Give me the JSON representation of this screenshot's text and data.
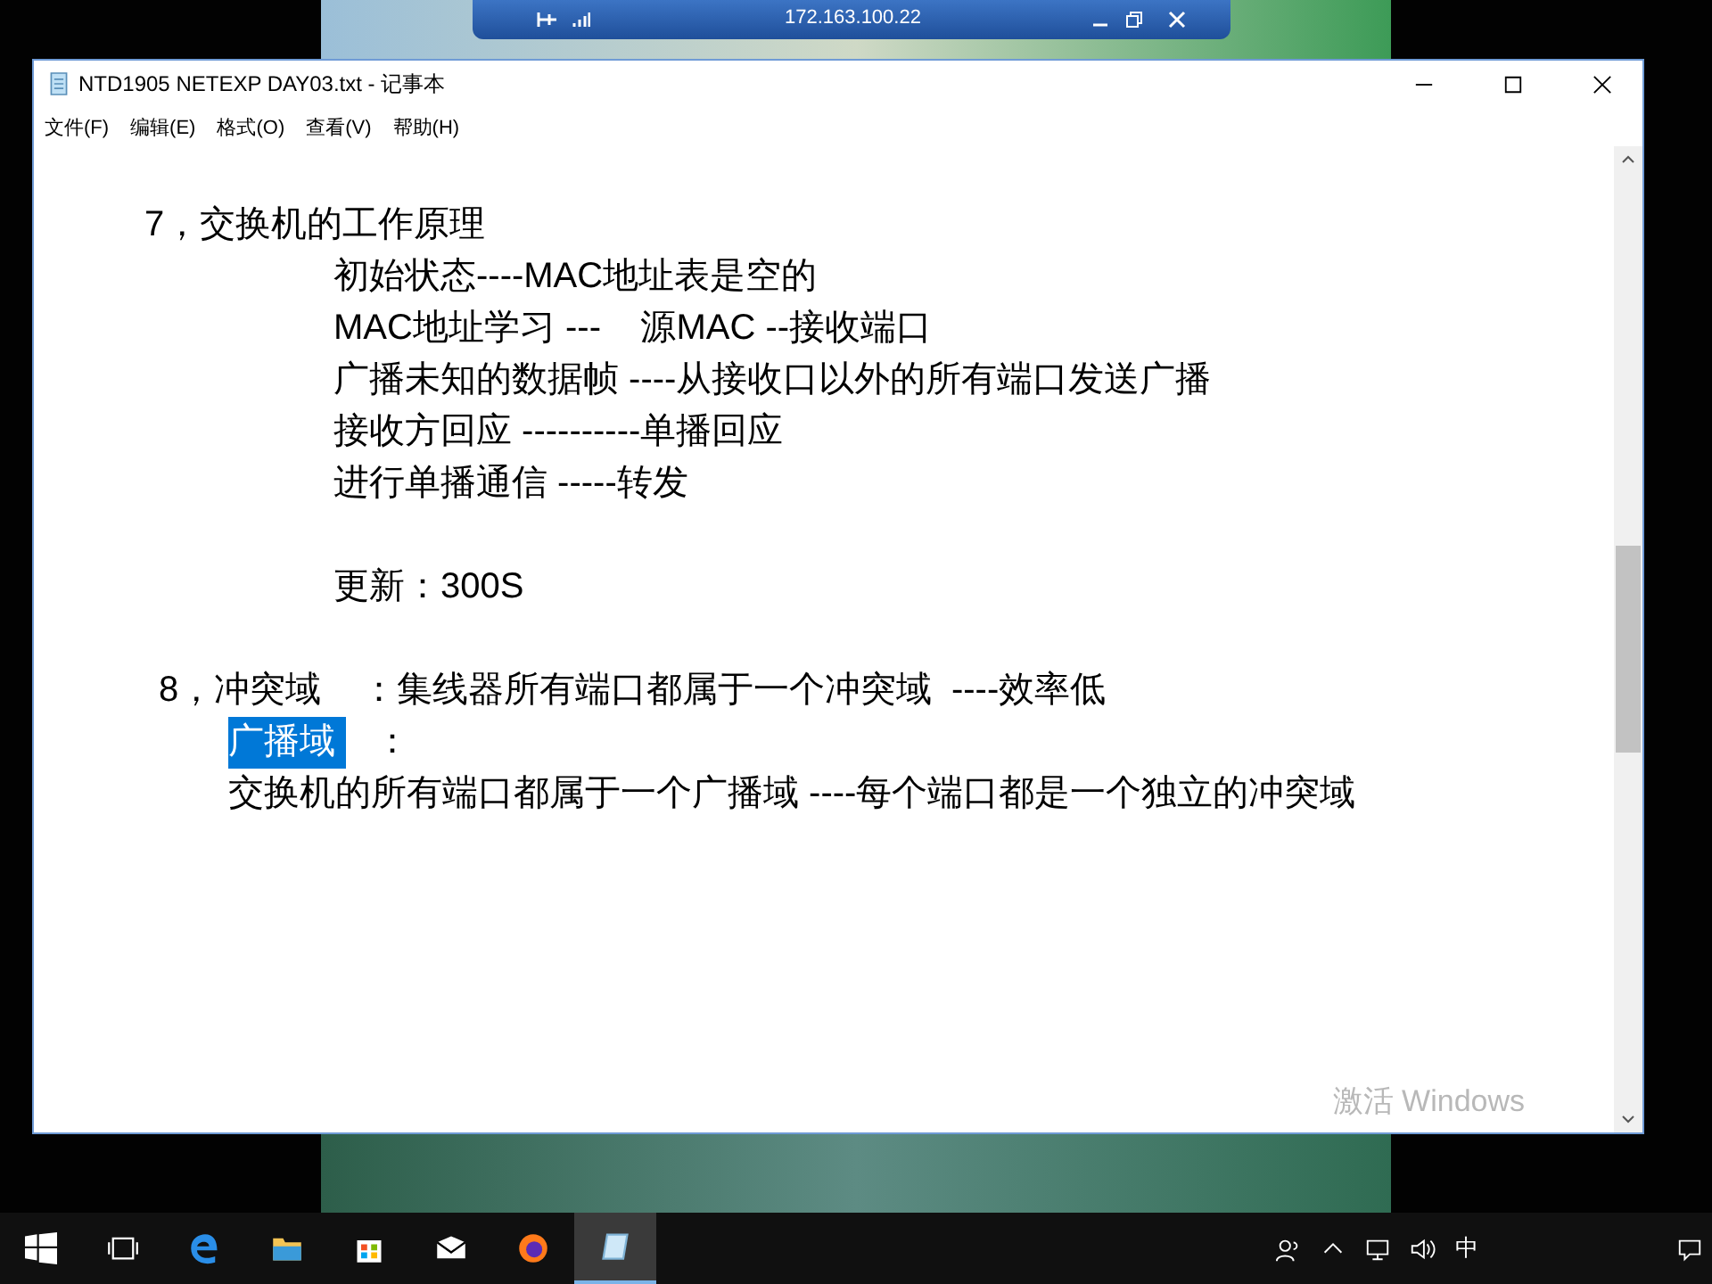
{
  "remote_bar": {
    "address": "172.163.100.22"
  },
  "window": {
    "title": "NTD1905 NETEXP DAY03.txt - 记事本"
  },
  "menu": [
    "文件(F)",
    "编辑(E)",
    "格式(O)",
    "查看(V)",
    "帮助(H)"
  ],
  "document": [
    {
      "kind": "heading",
      "segments": [
        {
          "text": "7，交换机的工作原理",
          "selected": false
        }
      ]
    },
    {
      "kind": "detail",
      "segments": [
        {
          "text": "初始状态----MAC地址表是空的",
          "selected": false
        }
      ]
    },
    {
      "kind": "detail",
      "segments": [
        {
          "text": "MAC地址学习 ---    源MAC --接收端口",
          "selected": false
        }
      ]
    },
    {
      "kind": "detail",
      "segments": [
        {
          "text": "广播未知的数据帧 ----从接收口以外的所有端口发送广播",
          "selected": false
        }
      ]
    },
    {
      "kind": "detail",
      "segments": [
        {
          "text": "接收方回应 ----------单播回应",
          "selected": false
        }
      ]
    },
    {
      "kind": "detail",
      "segments": [
        {
          "text": "进行单播通信 -----转发",
          "selected": false
        }
      ]
    },
    {
      "kind": "blank"
    },
    {
      "kind": "detail",
      "segments": [
        {
          "text": "更新：300S",
          "selected": false
        }
      ]
    },
    {
      "kind": "blank"
    },
    {
      "kind": "heading2",
      "segments": [
        {
          "text": "8，冲突域    ：集线器所有端口都属于一个冲突域  ----效率低",
          "selected": false
        }
      ]
    },
    {
      "kind": "continuation",
      "segments": [
        {
          "text": "广播域 ",
          "selected": true
        },
        {
          "text": "   ：",
          "selected": false
        }
      ]
    },
    {
      "kind": "continuation",
      "segments": [
        {
          "text": "交换机的所有端口都属于一个广播域 ----每个端口都是一个独立的冲突域",
          "selected": false
        }
      ]
    }
  ],
  "activation_notice": "激活 Windows",
  "taskbar": [
    {
      "kind": "start",
      "active": false
    },
    {
      "kind": "taskview",
      "active": false
    },
    {
      "kind": "edge",
      "active": false
    },
    {
      "kind": "explorer",
      "active": false
    },
    {
      "kind": "store",
      "active": false
    },
    {
      "kind": "mail",
      "active": false
    },
    {
      "kind": "firefox",
      "active": false
    },
    {
      "kind": "notepad",
      "active": true
    }
  ],
  "tray": {
    "ime": "中"
  }
}
